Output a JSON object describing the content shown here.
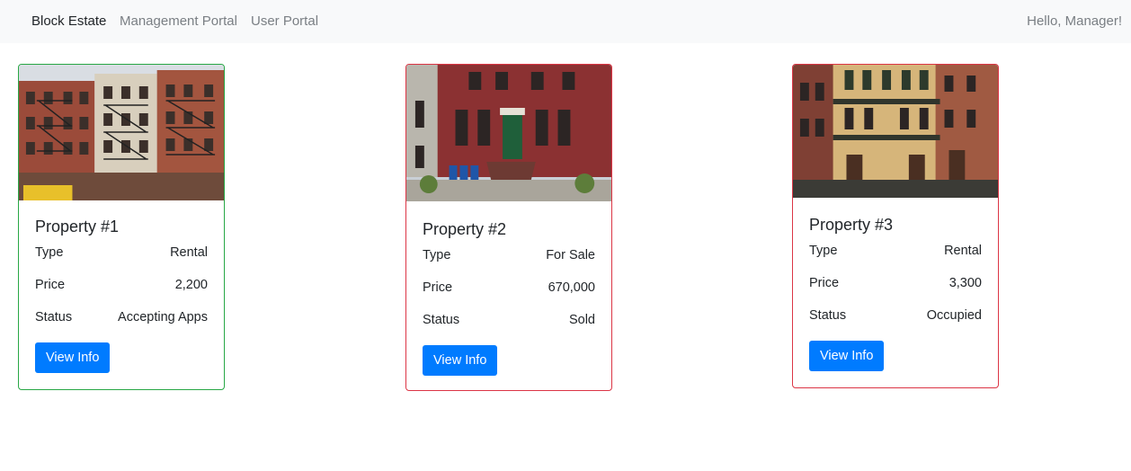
{
  "nav": {
    "brand": "Block Estate",
    "links": [
      "Management Portal",
      "User Portal"
    ],
    "greeting": "Hello, Manager!"
  },
  "labels": {
    "type": "Type",
    "price": "Price",
    "status": "Status",
    "button": "View Info"
  },
  "colors": {
    "accent": "#007bff",
    "border_available": "#28a745",
    "border_unavailable": "#dc3545",
    "navbar_bg": "#f8f9fa"
  },
  "properties": [
    {
      "title": "Property #1",
      "type": "Rental",
      "price": "2,200",
      "status": "Accepting Apps",
      "border": "green"
    },
    {
      "title": "Property #2",
      "type": "For Sale",
      "price": "670,000",
      "status": "Sold",
      "border": "red"
    },
    {
      "title": "Property #3",
      "type": "Rental",
      "price": "3,300",
      "status": "Occupied",
      "border": "red"
    }
  ]
}
